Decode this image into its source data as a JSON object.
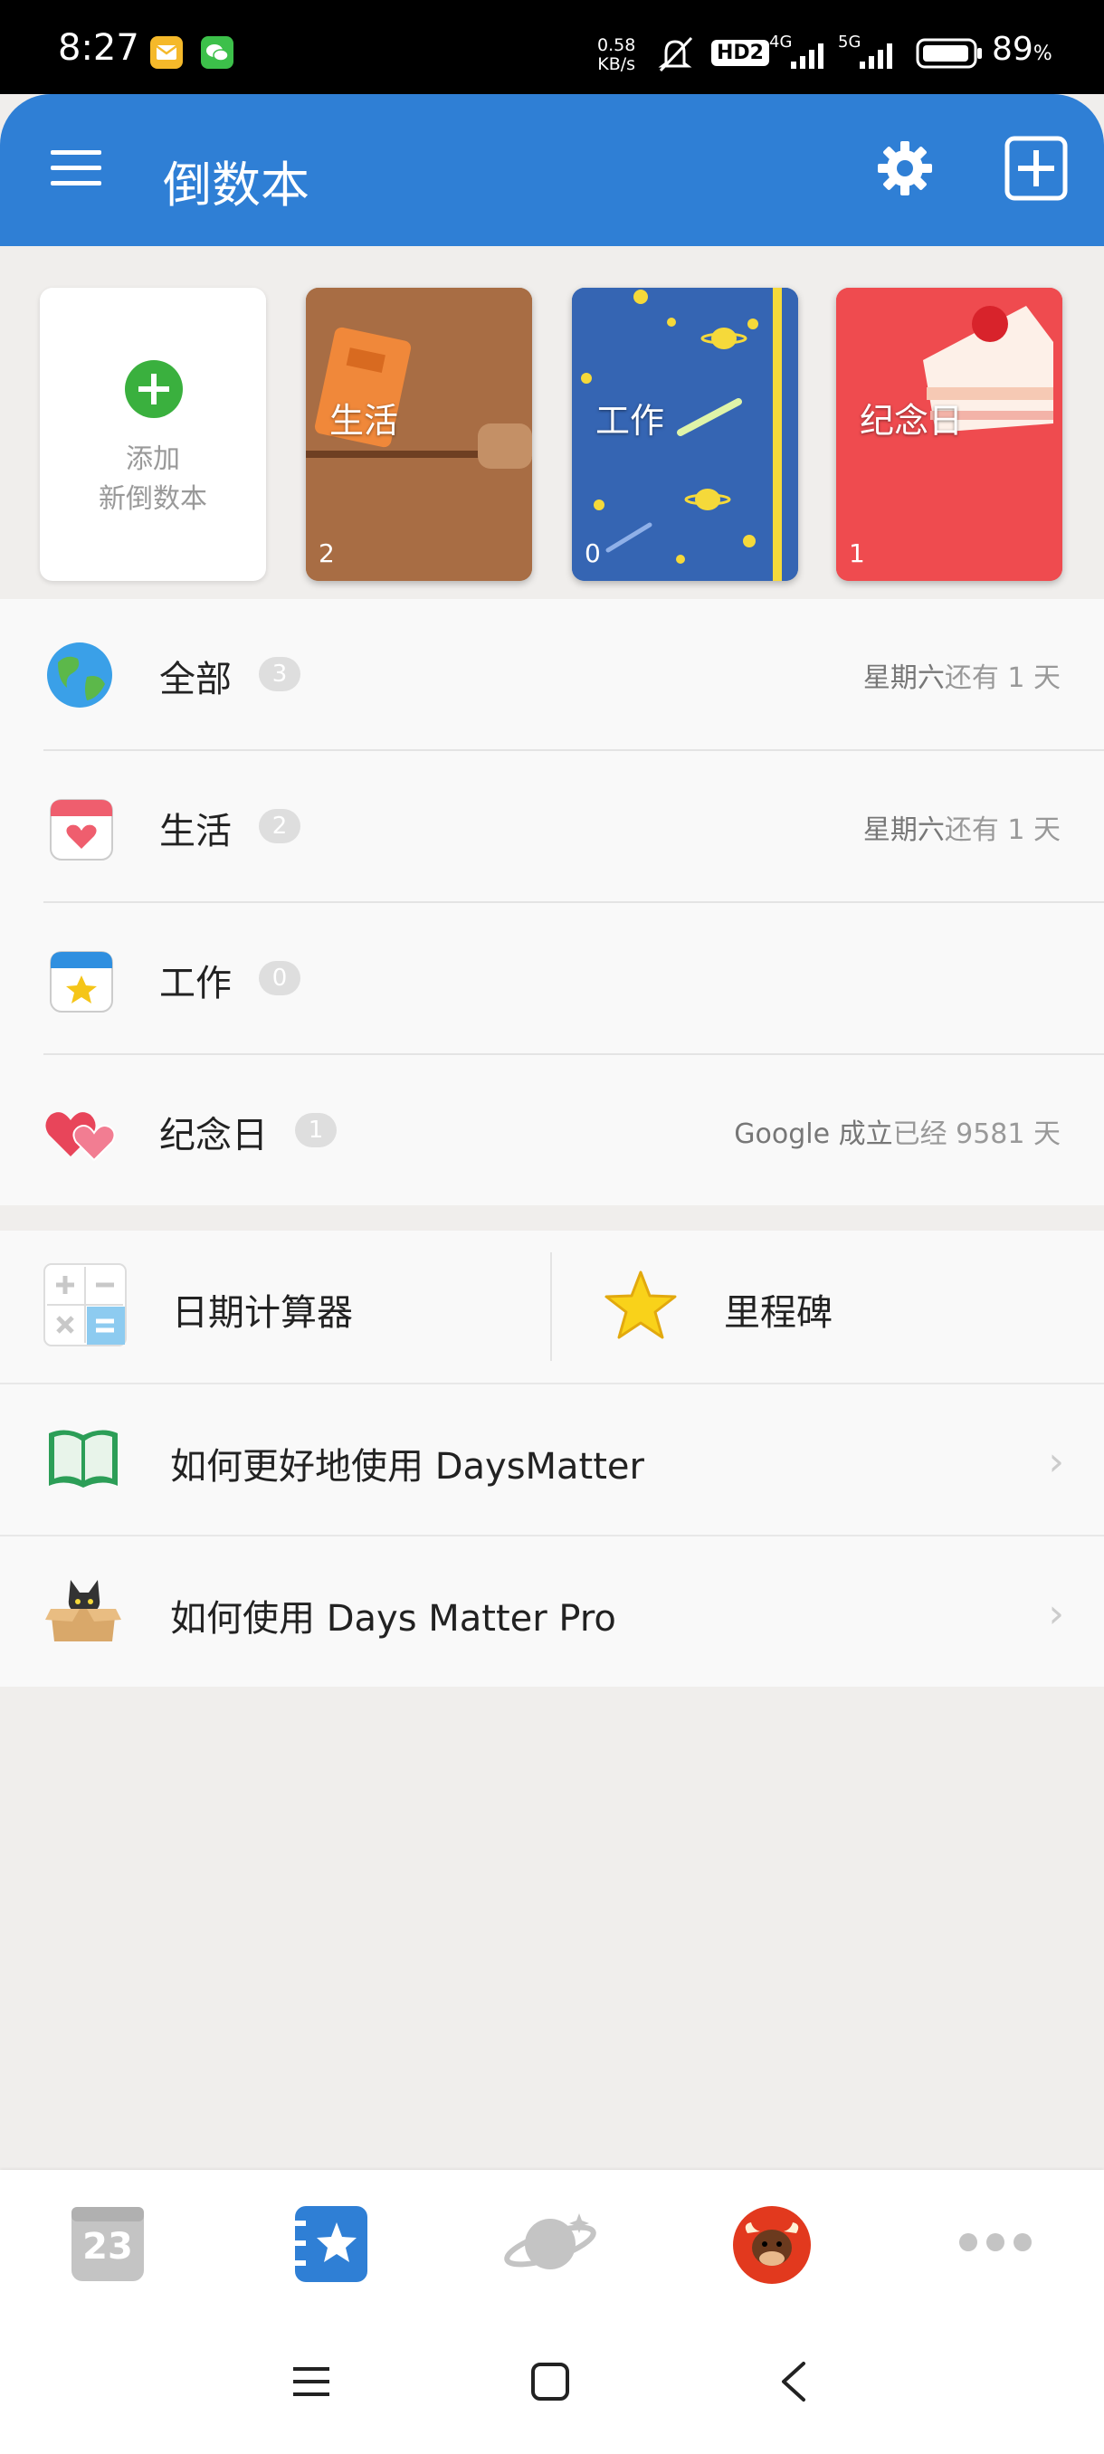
{
  "status_bar": {
    "time": "8:27",
    "speed_value": "0.58",
    "speed_unit": "KB/s",
    "hd_badge": "HD2",
    "network_4g": "4G",
    "network_5g": "5G",
    "battery_percent": "89",
    "battery_unit": "%"
  },
  "app_bar": {
    "title": "倒数本"
  },
  "notebooks": {
    "add_line1": "添加",
    "add_line2": "新倒数本",
    "items": [
      {
        "label": "生活",
        "count": "2",
        "color": "#a86d44"
      },
      {
        "label": "工作",
        "count": "0",
        "color": "#3565b3"
      },
      {
        "label": "纪念日",
        "count": "1",
        "color": "#ef4b4f"
      }
    ]
  },
  "categories": [
    {
      "label": "全部",
      "count": "3",
      "info_strong": "星期六",
      "info_rest": "还有 1 天"
    },
    {
      "label": "生活",
      "count": "2",
      "info_strong": "星期六",
      "info_rest": "还有 1 天"
    },
    {
      "label": "工作",
      "count": "0",
      "info_strong": "",
      "info_rest": ""
    },
    {
      "label": "纪念日",
      "count": "1",
      "info_strong": "Google 成立",
      "info_rest": "已经 9581 天"
    }
  ],
  "tools": {
    "calculator": "日期计算器",
    "milestone": "里程碑"
  },
  "help": [
    {
      "label": "如何更好地使用 DaysMatter"
    },
    {
      "label": "如何使用 Days Matter Pro"
    }
  ],
  "bottom_nav": {
    "calendar_day": "23"
  },
  "colors": {
    "primary": "#2f7fd5",
    "add_green": "#3ab03e",
    "badge": "#dedede"
  }
}
